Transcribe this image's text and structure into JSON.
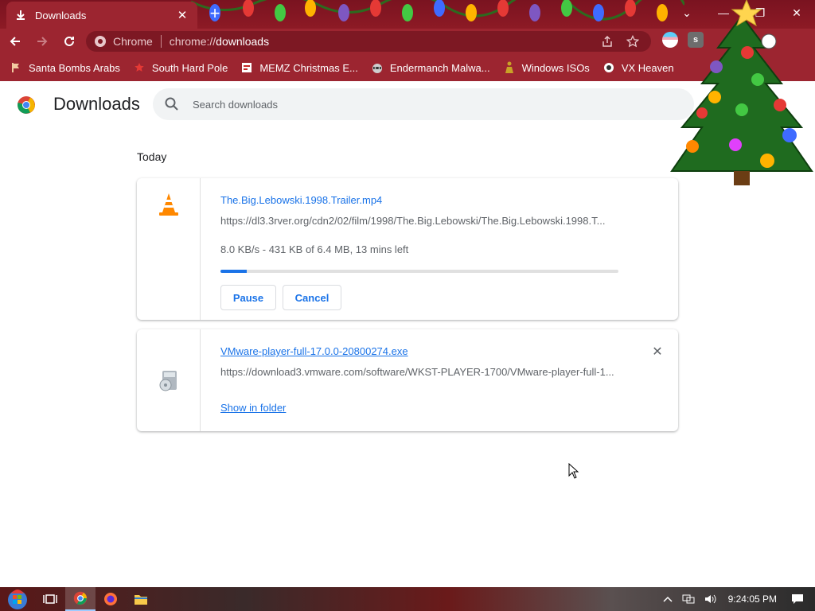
{
  "tab": {
    "title": "Downloads",
    "close": "✕"
  },
  "newtab": "+",
  "window": {
    "minimize": "—",
    "restore": "❐",
    "close": "✕",
    "tab_search": "⌄"
  },
  "omnibox": {
    "site": "Chrome",
    "scheme": "chrome://",
    "path": "downloads"
  },
  "bookmarks": [
    {
      "label": "Santa Bombs Arabs",
      "icon": "flag-icon"
    },
    {
      "label": "South Hard Pole",
      "icon": "star-icon"
    },
    {
      "label": "MEMZ Christmas E...",
      "icon": "page-icon"
    },
    {
      "label": "Endermanch Malwa...",
      "icon": "raccoon-icon"
    },
    {
      "label": "Windows ISOs",
      "icon": "figure-icon"
    },
    {
      "label": "VX Heaven",
      "icon": "bug-icon"
    }
  ],
  "page": {
    "title": "Downloads",
    "search_placeholder": "Search downloads",
    "date_header": "Today"
  },
  "downloads": [
    {
      "name": "The.Big.Lebowski.1998.Trailer.mp4",
      "url": "https://dl3.3rver.org/cdn2/02/film/1998/The.Big.Lebowski/The.Big.Lebowski.1998.T...",
      "status": "8.0 KB/s - 431 KB of 6.4 MB, 13 mins left",
      "progress": 0.066,
      "pause_label": "Pause",
      "cancel_label": "Cancel",
      "icon": "vlc-cone-icon"
    },
    {
      "name": "VMware-player-full-17.0.0-20800274.exe",
      "url": "https://download3.vmware.com/software/WKST-PLAYER-1700/VMware-player-full-1...",
      "show_label": "Show in folder",
      "remove": "✕",
      "icon": "installer-icon"
    }
  ],
  "taskbar": {
    "clock": "9:24:05 PM"
  },
  "colors": {
    "frame": "#9c2530",
    "accent": "#1a73e8",
    "text": "#202124",
    "muted": "#5f6368"
  }
}
